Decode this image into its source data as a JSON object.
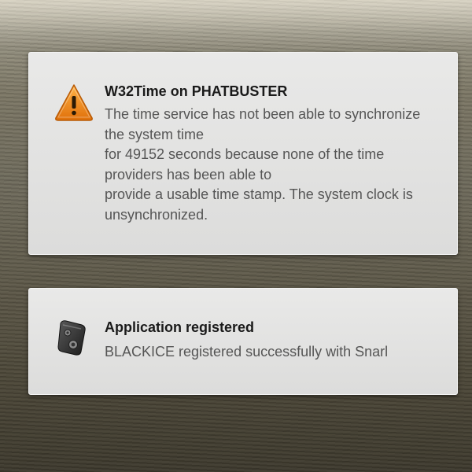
{
  "notifications": [
    {
      "icon": "warning-icon",
      "title": "W32Time on PHATBUSTER",
      "body_lines": [
        "The time service has not been able to synchronize",
        "the system time",
        "for 49152 seconds because none of the time",
        "providers has been able to",
        "provide a usable time stamp. The system clock is",
        "unsynchronized."
      ]
    },
    {
      "icon": "snarl-app-icon",
      "title": "Application registered",
      "body_lines": [
        "BLACKICE registered successfully with Snarl"
      ]
    }
  ],
  "colors": {
    "warning_orange": "#f08a1a",
    "title_text": "#1a1a1a",
    "body_text": "#555555",
    "card_background": "#e4e4e3"
  }
}
